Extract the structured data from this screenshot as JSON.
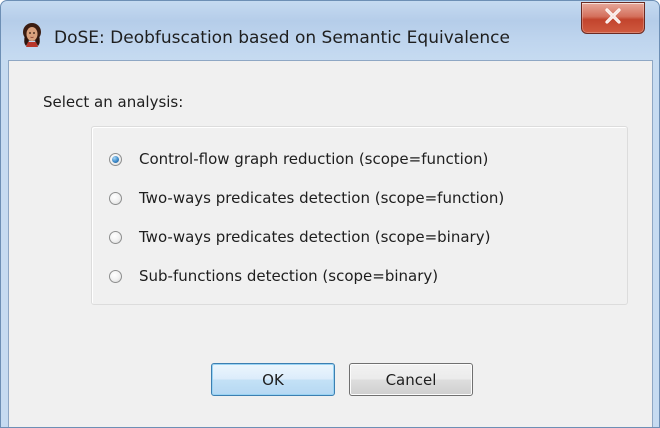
{
  "window": {
    "title": "DoSE: Deobfuscation based on Semantic Equivalence",
    "icon": "app-portrait-icon",
    "close_icon": "close-icon"
  },
  "dialog": {
    "prompt": "Select an analysis:",
    "options": [
      {
        "label": "Control-flow graph reduction (scope=function)",
        "selected": true
      },
      {
        "label": "Two-ways predicates detection (scope=function)",
        "selected": false
      },
      {
        "label": "Two-ways predicates detection (scope=binary)",
        "selected": false
      },
      {
        "label": "Sub-functions detection (scope=binary)",
        "selected": false
      }
    ],
    "ok_label": "OK",
    "cancel_label": "Cancel"
  },
  "colors": {
    "frame": "#c5daf1",
    "client": "#f0f0f0",
    "close_button": "#c7432b",
    "radio_checked": "#3c8ac9",
    "ok_border": "#3c7fb1"
  }
}
